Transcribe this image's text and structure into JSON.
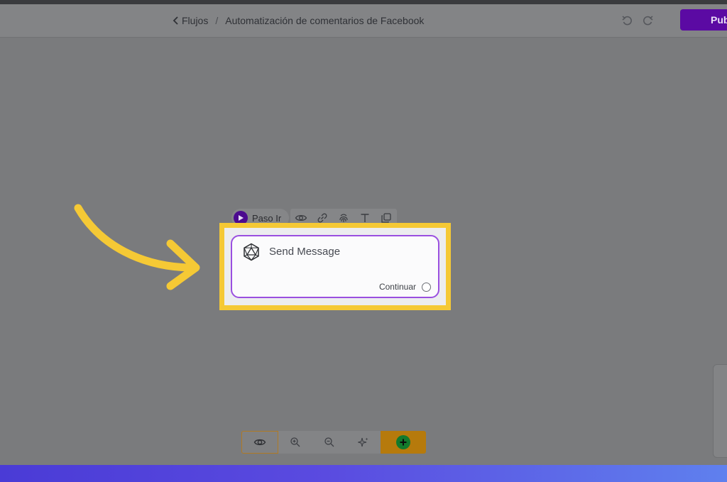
{
  "header": {
    "breadcrumb": {
      "back_label": "Flujos",
      "separator": "/",
      "current": "Automatización de comentarios de Facebook"
    },
    "publish_label": "Pub"
  },
  "node": {
    "step_chip_label": "Paso Ir",
    "title": "Send Message",
    "output_label": "Continuar",
    "icon": "icosahedron-icon"
  },
  "colors": {
    "accent": "#5b0aa3",
    "highlight": "#f5c935",
    "node_border": "#9a4fe0",
    "add_button": "#b67a0c",
    "add_icon": "#137a2c"
  }
}
